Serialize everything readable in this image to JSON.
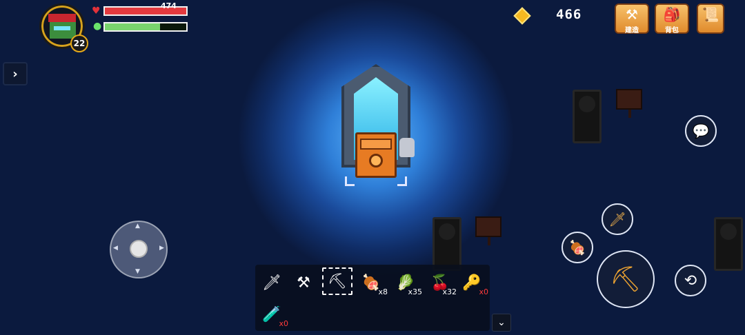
{
  "hud": {
    "level": "22",
    "hp_text": "474",
    "hp_fraction": 1.0,
    "stamina_fraction": 0.68,
    "gem_count": "466",
    "icons": {
      "hp": "heart-icon",
      "stamina": "droplet-icon",
      "gem": "gem-icon"
    }
  },
  "top_buttons": [
    {
      "label": "建造",
      "icon": "anvil-icon"
    },
    {
      "label": "背包",
      "icon": "backpack-icon"
    },
    {
      "label": "",
      "icon": "scroll-icon"
    }
  ],
  "hotbar": {
    "selected_index": 2,
    "slots": [
      {
        "icon": "golden-sword-icon",
        "glyph": "🗡",
        "count": ""
      },
      {
        "icon": "shovel-icon",
        "glyph": "⚒",
        "count": ""
      },
      {
        "icon": "pickaxe-icon",
        "glyph": "⛏",
        "count": ""
      },
      {
        "icon": "meat-icon",
        "glyph": "🍖",
        "count": "x8"
      },
      {
        "icon": "radish-icon",
        "glyph": "🥬",
        "count": "x35"
      },
      {
        "icon": "berries-icon",
        "glyph": "🍒",
        "count": "x32"
      },
      {
        "icon": "key-icon",
        "glyph": "🔑",
        "count": "x0"
      },
      {
        "icon": "potion-bottle-icon",
        "glyph": "🧪",
        "count": "x0"
      }
    ]
  },
  "actions": {
    "chat_icon": "chat-bubble-icon",
    "skill_icon": "golden-sword-icon",
    "food_icon": "meat-icon",
    "attack_icon": "pickaxe-icon",
    "dodge_icon": "dodge-roll-icon"
  },
  "colors": {
    "hp": "#e33a3f",
    "stamina": "#79d46d",
    "gem": "#f5b820",
    "accent": "#e08a2c"
  }
}
